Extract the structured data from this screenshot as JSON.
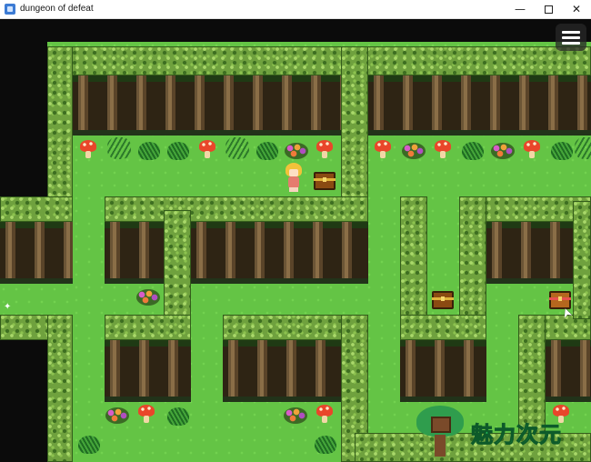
{
  "window": {
    "title": "dungeon of defeat",
    "controls": {
      "minimize": "—",
      "close": "✕"
    }
  },
  "game": {
    "menu_icon": "hamburger-menu-icon",
    "watermark_text": "魅力次元",
    "colors": {
      "grass": "#64c445",
      "hedge": "#6fa13e",
      "trunk": "#6b5536",
      "void": "#0b0b0b"
    },
    "sparkle_glyph": "✦",
    "cursor_glyph": "➤"
  }
}
